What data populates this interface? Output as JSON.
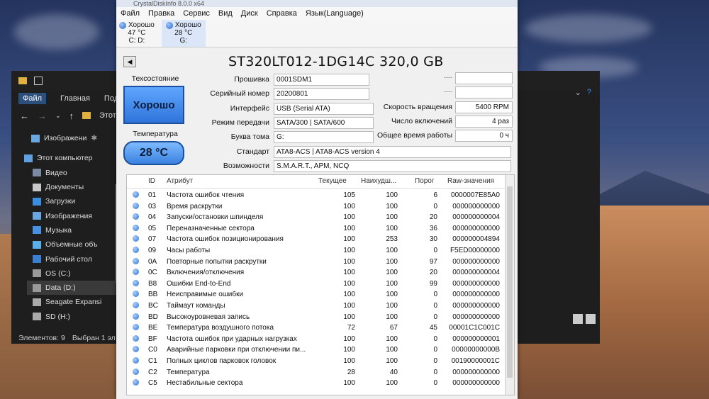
{
  "explorer": {
    "ribbon": [
      "Файл",
      "Главная",
      "Подел"
    ],
    "nav_partial": "Этот",
    "quick_access": "Изображени",
    "items": [
      {
        "label": "Этот компьютер",
        "icon": "computer-icon"
      },
      {
        "label": "Видео",
        "icon": "video-folder-icon"
      },
      {
        "label": "Документы",
        "icon": "documents-folder-icon"
      },
      {
        "label": "Загрузки",
        "icon": "downloads-folder-icon"
      },
      {
        "label": "Изображения",
        "icon": "pictures-folder-icon"
      },
      {
        "label": "Музыка",
        "icon": "music-folder-icon"
      },
      {
        "label": "Объемные объ",
        "icon": "3d-objects-icon"
      },
      {
        "label": "Рабочий стол",
        "icon": "desktop-folder-icon"
      },
      {
        "label": "OS (C:)",
        "icon": "drive-c-icon"
      },
      {
        "label": "Data (D:)",
        "icon": "drive-d-icon"
      },
      {
        "label": "Seagate Expansi",
        "icon": "external-drive-icon"
      },
      {
        "label": "SD (H:)",
        "icon": "sd-card-icon"
      }
    ],
    "status_count": "Элементов: 9",
    "status_selected": "Выбран 1 эл"
  },
  "cdi": {
    "title": "CrystalDiskInfo 8.0.0 x64",
    "menu": [
      "Файл",
      "Правка",
      "Сервис",
      "Вид",
      "Диск",
      "Справка",
      "Язык(Language)"
    ],
    "drives": [
      {
        "status": "Хорошо",
        "temp": "47 °C",
        "letter": "C: D:"
      },
      {
        "status": "Хорошо",
        "temp": "28 °C",
        "letter": "G:"
      }
    ],
    "model": "ST320LT012-1DG14C 320,0 GB",
    "health_label": "Техсостояние",
    "health_value": "Хорошо",
    "temp_label": "Температура",
    "temp_value": "28 °C",
    "fields": {
      "firmware_label": "Прошивка",
      "firmware": "0001SDM1",
      "serial_label": "Серийный номер",
      "serial": "20200801",
      "interface_label": "Интерфейс",
      "interface": "USB (Serial ATA)",
      "transfer_label": "Режим передачи",
      "transfer": "SATA/300 | SATA/600",
      "volume_label": "Буква тома",
      "volume": "G:",
      "standard_label": "Стандарт",
      "standard": "ATA8-ACS | ATA8-ACS version 4",
      "features_label": "Возможности",
      "features": "S.M.A.R.T., APM, NCQ",
      "dash1": "----",
      "dash2": "----",
      "rpm_label": "Скорость вращения",
      "rpm": "5400 RPM",
      "power_count_label": "Число включений",
      "power_count": "4 раз",
      "power_hours_label": "Общее время работы",
      "power_hours": "0 ч"
    },
    "table": {
      "headers": {
        "id": "ID",
        "attr": "Атрибут",
        "current": "Текущее",
        "worst": "Наихудш...",
        "threshold": "Порог",
        "raw": "Raw-значения"
      },
      "rows": [
        {
          "id": "01",
          "name": "Частота ошибок чтения",
          "cur": "105",
          "worst": "100",
          "thr": "6",
          "raw": "0000007E85A0"
        },
        {
          "id": "03",
          "name": "Время раскрутки",
          "cur": "100",
          "worst": "100",
          "thr": "0",
          "raw": "000000000000"
        },
        {
          "id": "04",
          "name": "Запуски/остановки шпинделя",
          "cur": "100",
          "worst": "100",
          "thr": "20",
          "raw": "000000000004"
        },
        {
          "id": "05",
          "name": "Переназначенные сектора",
          "cur": "100",
          "worst": "100",
          "thr": "36",
          "raw": "000000000000"
        },
        {
          "id": "07",
          "name": "Частота ошибок позиционирования",
          "cur": "100",
          "worst": "253",
          "thr": "30",
          "raw": "000000004894"
        },
        {
          "id": "09",
          "name": "Часы работы",
          "cur": "100",
          "worst": "100",
          "thr": "0",
          "raw": "F5ED00000000"
        },
        {
          "id": "0A",
          "name": "Повторные попытки раскрутки",
          "cur": "100",
          "worst": "100",
          "thr": "97",
          "raw": "000000000000"
        },
        {
          "id": "0C",
          "name": "Включения/отключения",
          "cur": "100",
          "worst": "100",
          "thr": "20",
          "raw": "000000000004"
        },
        {
          "id": "B8",
          "name": "Ошибки End-to-End",
          "cur": "100",
          "worst": "100",
          "thr": "99",
          "raw": "000000000000"
        },
        {
          "id": "BB",
          "name": "Неисправимые ошибки",
          "cur": "100",
          "worst": "100",
          "thr": "0",
          "raw": "000000000000"
        },
        {
          "id": "BC",
          "name": "Таймаут команды",
          "cur": "100",
          "worst": "100",
          "thr": "0",
          "raw": "000000000000"
        },
        {
          "id": "BD",
          "name": "Высокоуровневая запись",
          "cur": "100",
          "worst": "100",
          "thr": "0",
          "raw": "000000000000"
        },
        {
          "id": "BE",
          "name": "Температура воздушного потока",
          "cur": "72",
          "worst": "67",
          "thr": "45",
          "raw": "00001C1C001C"
        },
        {
          "id": "BF",
          "name": "Частота ошибок при ударных нагрузках",
          "cur": "100",
          "worst": "100",
          "thr": "0",
          "raw": "000000000001"
        },
        {
          "id": "C0",
          "name": "Аварийные парковки при отключении пи...",
          "cur": "100",
          "worst": "100",
          "thr": "0",
          "raw": "00000000000B"
        },
        {
          "id": "C1",
          "name": "Полных циклов парковок головок",
          "cur": "100",
          "worst": "100",
          "thr": "0",
          "raw": "00190000001C"
        },
        {
          "id": "C2",
          "name": "Температура",
          "cur": "28",
          "worst": "40",
          "thr": "0",
          "raw": "000000000000"
        },
        {
          "id": "C5",
          "name": "Нестабильные сектора",
          "cur": "100",
          "worst": "100",
          "thr": "0",
          "raw": "000000000000"
        }
      ]
    }
  }
}
